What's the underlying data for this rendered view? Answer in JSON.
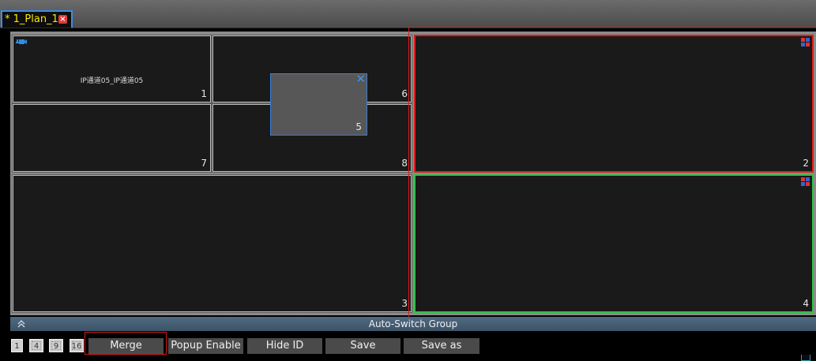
{
  "tab": {
    "title": "* 1_Plan_1",
    "close_glyph": "×"
  },
  "cells": [
    {
      "id": "1",
      "title": "IP通道05_IP通道05"
    },
    {
      "id": "6"
    },
    {
      "id": "7"
    },
    {
      "id": "8"
    },
    {
      "id": "2"
    },
    {
      "id": "3"
    },
    {
      "id": "4"
    }
  ],
  "overlay": {
    "id": "5",
    "close_glyph": "✕"
  },
  "side_tab": {
    "glyph": "<"
  },
  "auto_switch": {
    "label": "Auto-Switch Group"
  },
  "layouts": [
    "1",
    "4",
    "9",
    "16"
  ],
  "actions": {
    "merge": "Merge",
    "popup_enable": "Popup Enable",
    "hide_id": "Hide ID",
    "save": "Save",
    "save_as": "Save as"
  },
  "colors": {
    "tab_text": "#f5e600",
    "active_border": "#3a8ee8",
    "selection_red": "#e11b1b",
    "selection_green": "#33c04a",
    "auto_switch_bar": "#4f6a82"
  }
}
